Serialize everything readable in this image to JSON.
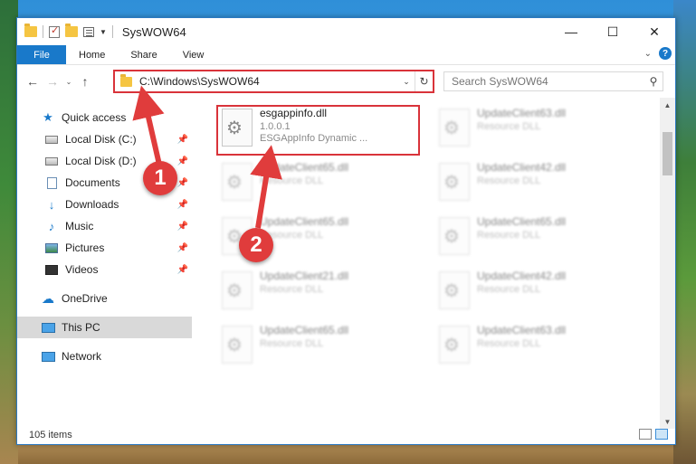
{
  "window": {
    "title": "SysWOW64",
    "controls": {
      "minimize": "—",
      "maximize": "☐",
      "close": "✕"
    }
  },
  "ribbon": {
    "tabs": [
      "File",
      "Home",
      "Share",
      "View"
    ]
  },
  "address": {
    "path": "C:\\Windows\\SysWOW64",
    "search_placeholder": "Search SysWOW64"
  },
  "nav": {
    "items": [
      {
        "label": "Quick access",
        "icon": "star-icon"
      },
      {
        "label": "Local Disk (C:)",
        "icon": "disk-icon",
        "pinned": true
      },
      {
        "label": "Local Disk (D:)",
        "icon": "disk-icon",
        "pinned": true
      },
      {
        "label": "Documents",
        "icon": "documents-icon",
        "pinned": true
      },
      {
        "label": "Downloads",
        "icon": "downloads-icon",
        "pinned": true
      },
      {
        "label": "Music",
        "icon": "music-icon",
        "pinned": true
      },
      {
        "label": "Pictures",
        "icon": "pictures-icon",
        "pinned": true
      },
      {
        "label": "Videos",
        "icon": "videos-icon",
        "pinned": true
      },
      {
        "label": "OneDrive",
        "icon": "cloud-icon"
      },
      {
        "label": "This PC",
        "icon": "computer-icon",
        "selected": true
      },
      {
        "label": "Network",
        "icon": "network-icon"
      }
    ]
  },
  "files": [
    {
      "name": "esgappinfo.dll",
      "line2": "1.0.0.1",
      "line3": "ESGAppInfo Dynamic ..."
    },
    {
      "name": "UpdateClient63.dll",
      "line2": "Resource DLL"
    },
    {
      "name": "UpdateClient65.dll",
      "line2": "Resource DLL"
    },
    {
      "name": "UpdateClient42.dll",
      "line2": "Resource DLL"
    },
    {
      "name": "UpdateClient65.dll",
      "line2": "Resource DLL"
    },
    {
      "name": "UpdateClient65.dll",
      "line2": "Resource DLL"
    },
    {
      "name": "UpdateClient21.dll",
      "line2": "Resource DLL"
    },
    {
      "name": "UpdateClient42.dll",
      "line2": "Resource DLL"
    },
    {
      "name": "UpdateClient65.dll",
      "line2": "Resource DLL"
    },
    {
      "name": "UpdateClient63.dll",
      "line2": "Resource DLL"
    }
  ],
  "status": {
    "item_count": "105 items"
  },
  "annotations": {
    "step1": "1",
    "step2": "2"
  },
  "colors": {
    "accent": "#1979ca",
    "highlight": "#d9333a",
    "badge": "#e03c3c"
  }
}
